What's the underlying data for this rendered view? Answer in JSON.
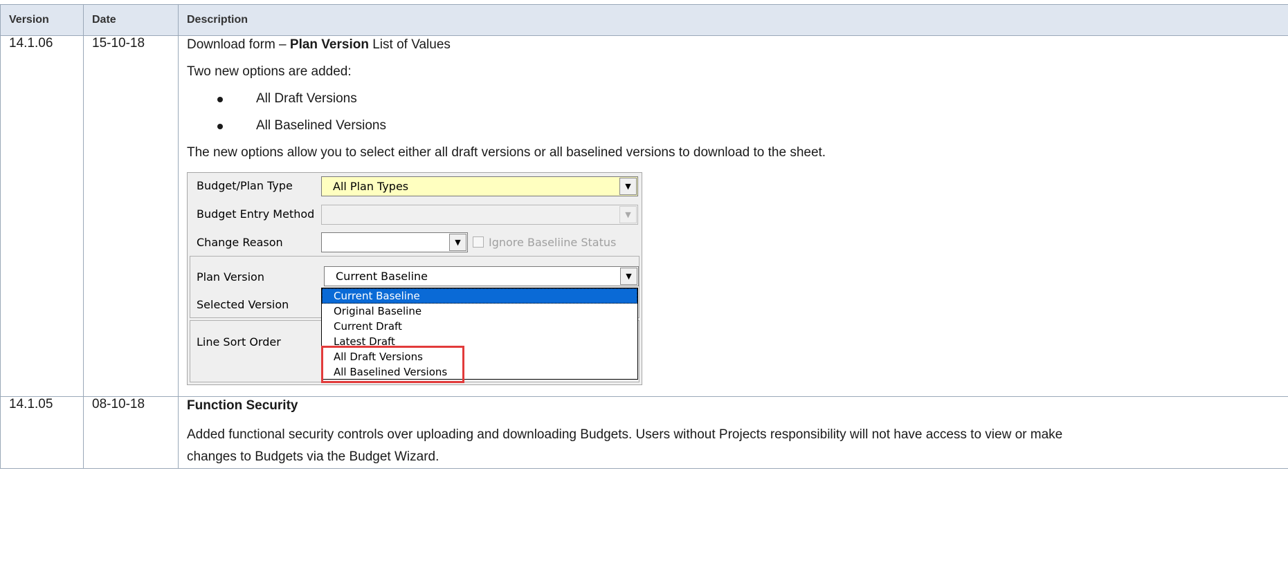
{
  "table": {
    "headers": {
      "version": "Version",
      "date": "Date",
      "description": "Description"
    },
    "row1": {
      "version": "14.1.06",
      "date": "15-10-18",
      "line1_prefix": "Download form – ",
      "line1_bold": "Plan Version",
      "line1_suffix": " List of Values",
      "line2": "Two new options are added:",
      "bullets": [
        "All Draft Versions",
        "All Baselined Versions"
      ],
      "line3": "The new options allow you to select either all draft versions or all baselined versions to download to the sheet."
    },
    "row2": {
      "version": "14.1.05",
      "date": "08-10-18",
      "title": "Function Security",
      "body": "Added functional security controls over uploading and downloading Budgets. Users without Projects responsibility will not have access to view or make changes to Budgets via the Budget Wizard."
    }
  },
  "form": {
    "labels": {
      "plan_type": "Budget/Plan Type",
      "entry_method": "Budget Entry Method",
      "change_reason": "Change Reason",
      "plan_version": "Plan Version",
      "selected_version": "Selected Version",
      "line_sort": "Line Sort Order"
    },
    "plan_type_value": "All Plan Types",
    "ignore_baseline_label": "Ignore Baseliine Status",
    "plan_version_value": "Current Baseline",
    "dropdown_options": [
      "Current Baseline",
      "Original Baseline",
      "Current Draft",
      "Latest Draft",
      "All Draft Versions",
      "All Baselined Versions"
    ],
    "highlight_color": "#e23b3b",
    "plan_type_bg": "#ffffc0",
    "selection_color": "#0a6ad6"
  }
}
